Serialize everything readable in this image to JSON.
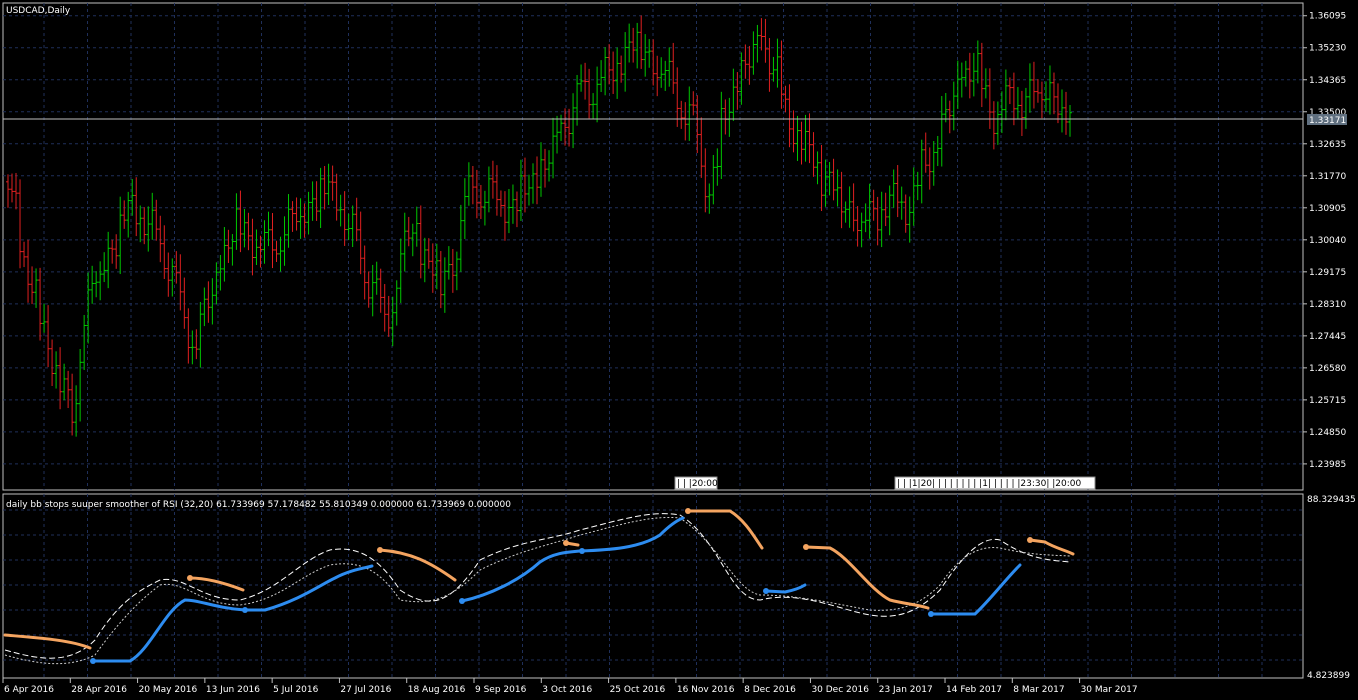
{
  "main_chart": {
    "title": "USDCAD,Daily",
    "price_scale": [
      "1.36095",
      "1.35230",
      "1.34365",
      "1.33500",
      "1.32635",
      "1.31770",
      "1.30905",
      "1.30040",
      "1.29175",
      "1.28310",
      "1.27445",
      "1.26580",
      "1.25715",
      "1.24850",
      "1.23985"
    ],
    "current_price": "1.33171",
    "ymin": 1.2355,
    "ymax": 1.3625,
    "bull_color": "#00c800",
    "bear_color": "#e02020",
    "time_markers": [
      "| | |20:00",
      "| | |1|20| | | | | | | | |1| | | | | |23:30| |20:00"
    ]
  },
  "indicator": {
    "title": "daily bb stops suuper smoother of RSI (32,20) 61.733969 57.178482 55.810349 0.000000 61.733969 0.000000",
    "scale_max": "88.329435",
    "scale_min": "4.823899",
    "up_color": "#2d8cf0",
    "down_color": "#f4a460"
  },
  "time_axis": [
    "6 Apr 2016",
    "28 Apr 2016",
    "20 May 2016",
    "13 Jun 2016",
    "5 Jul 2016",
    "27 Jul 2016",
    "18 Aug 2016",
    "9 Sep 2016",
    "3 Oct 2016",
    "25 Oct 2016",
    "16 Nov 2016",
    "8 Dec 2016",
    "30 Dec 2016",
    "23 Jan 2017",
    "14 Feb 2017",
    "8 Mar 2017",
    "30 Mar 2017"
  ],
  "chart_data": {
    "type": "candlestick",
    "symbol": "USDCAD",
    "timeframe": "Daily",
    "x_range": [
      "6 Apr 2016",
      "12 Apr 2017"
    ],
    "y_range": [
      1.2355,
      1.3625
    ],
    "anchor_closes": [
      [
        "6 Apr 2016",
        1.315
      ],
      [
        "15 Apr 2016",
        1.285
      ],
      [
        "28 Apr 2016",
        1.253
      ],
      [
        "5 May 2016",
        1.288
      ],
      [
        "19 May 2016",
        1.31
      ],
      [
        "31 May 2016",
        1.297
      ],
      [
        "10 Jun 2016",
        1.27
      ],
      [
        "24 Jun 2016",
        1.305
      ],
      [
        "6 Jul 2016",
        1.298
      ],
      [
        "19 Jul 2016",
        1.31
      ],
      [
        "27 Jul 2016",
        1.315
      ],
      [
        "5 Aug 2016",
        1.3
      ],
      [
        "16 Aug 2016",
        1.278
      ],
      [
        "25 Aug 2016",
        1.303
      ],
      [
        "5 Sep 2016",
        1.288
      ],
      [
        "15 Sep 2016",
        1.315
      ],
      [
        "29 Sep 2016",
        1.31
      ],
      [
        "11 Oct 2016",
        1.32
      ],
      [
        "21 Oct 2016",
        1.338
      ],
      [
        "3 Nov 2016",
        1.345
      ],
      [
        "11 Nov 2016",
        1.355
      ],
      [
        "22 Nov 2016",
        1.345
      ],
      [
        "1 Dec 2016",
        1.332
      ],
      [
        "7 Dec 2016",
        1.315
      ],
      [
        "15 Dec 2016",
        1.34
      ],
      [
        "26 Dec 2016",
        1.355
      ],
      [
        "3 Jan 2017",
        1.335
      ],
      [
        "9 Jan 2017",
        1.325
      ],
      [
        "19 Jan 2017",
        1.315
      ],
      [
        "30 Jan 2017",
        1.305
      ],
      [
        "6 Feb 2017",
        1.31
      ],
      [
        "14 Feb 2017",
        1.31
      ],
      [
        "24 Feb 2017",
        1.325
      ],
      [
        "6 Mar 2017",
        1.345
      ],
      [
        "9 Mar 2017",
        1.348
      ],
      [
        "16 Mar 2017",
        1.335
      ],
      [
        "29 Mar 2017",
        1.34
      ],
      [
        "5 Apr 2017",
        1.342
      ],
      [
        "12 Apr 2017",
        1.3317
      ]
    ]
  }
}
